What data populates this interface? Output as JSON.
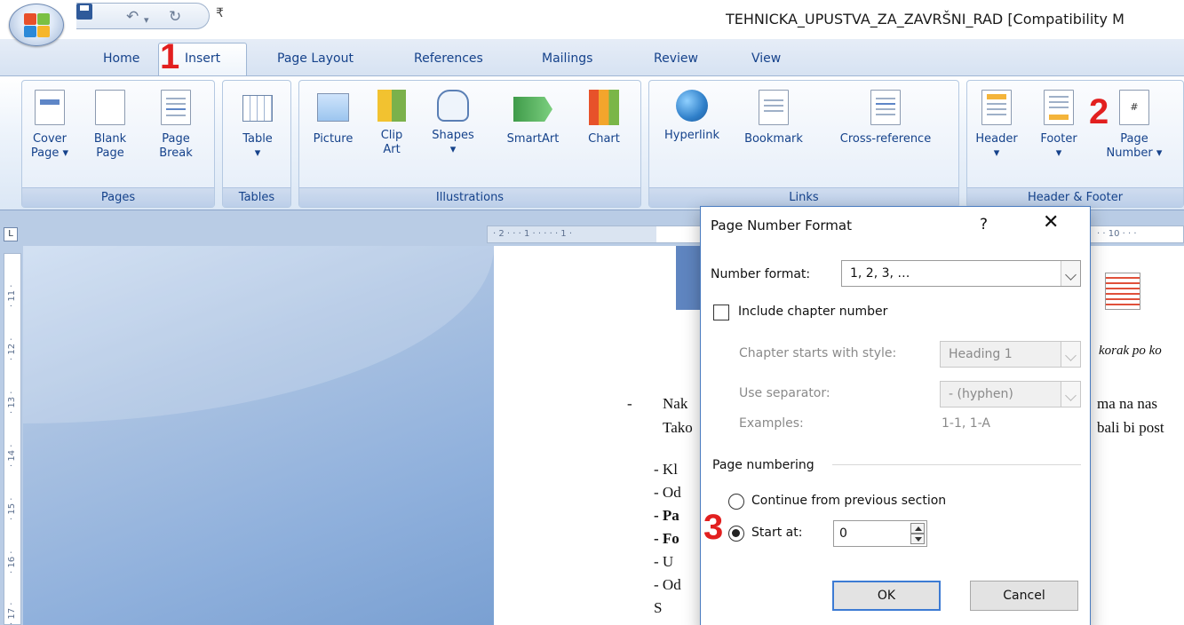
{
  "window": {
    "title": "TEHNICKA_UPUSTVA_ZA_ZAVRŠNI_RAD [Compatibility M"
  },
  "quick_access": {
    "save_icon": "save-icon",
    "undo_icon": "undo-icon",
    "redo_icon": "redo-icon",
    "more": "₹"
  },
  "tabs": [
    {
      "label": "Home"
    },
    {
      "label": "Insert",
      "selected": true
    },
    {
      "label": "Page Layout"
    },
    {
      "label": "References"
    },
    {
      "label": "Mailings"
    },
    {
      "label": "Review"
    },
    {
      "label": "View"
    }
  ],
  "ribbon": {
    "pages": {
      "label": "Pages",
      "cover_page": "Cover",
      "cover_page2": "Page ▾",
      "blank_page": "Blank",
      "blank_page2": "Page",
      "page_break": "Page",
      "page_break2": "Break"
    },
    "tables": {
      "label": "Tables",
      "table": "Table",
      "table2": "▾"
    },
    "illustrations": {
      "label": "Illustrations",
      "picture": "Picture",
      "clip_art": "Clip",
      "clip_art2": "Art",
      "shapes": "Shapes",
      "shapes2": "▾",
      "smartart": "SmartArt",
      "chart": "Chart"
    },
    "links": {
      "label": "Links",
      "hyperlink": "Hyperlink",
      "bookmark": "Bookmark",
      "cross_reference": "Cross-reference"
    },
    "header_footer": {
      "label": "Header & Footer",
      "header": "Header",
      "header2": "▾",
      "footer": "Footer",
      "footer2": "▾",
      "page_number": "Page",
      "page_number2": "Number ▾"
    }
  },
  "ruler": {
    "corner": "L",
    "horizontal": "· 2 · · · 1 · · ·   · · 1 ·",
    "horizontal_right": "· · 10 · · ·",
    "vertical": [
      "· 11 ·",
      "· 12 ·",
      "· 13 ·",
      "· 14 ·",
      "· 15 ·",
      "· 16 ·",
      "· 17 ·"
    ]
  },
  "document": {
    "caption_right": "korak po ko",
    "dash": "-",
    "line1_left": "Nak",
    "line1_right": "ma na nas",
    "line2_left": "Tako",
    "line2_right": "bali bi post",
    "items": [
      "- Kl",
      "- Od",
      "- Pa",
      "- Fo",
      "- U",
      "- Od",
      "S"
    ]
  },
  "dialog": {
    "title": "Page Number Format",
    "help": "?",
    "close": "✕",
    "number_format_label": "Number format:",
    "number_format_value": "1, 2, 3, …",
    "include_chapter_label": "Include chapter number",
    "include_chapter_checked": false,
    "chapter_style_label": "Chapter starts with style:",
    "chapter_style_value": "Heading 1",
    "separator_label": "Use separator:",
    "separator_value": "-   (hyphen)",
    "examples_label": "Examples:",
    "examples_value": "1-1, 1-A",
    "page_numbering_label": "Page numbering",
    "continue_label": "Continue from previous section",
    "start_at_label": "Start at:",
    "start_at_value": "0",
    "ok": "OK",
    "cancel": "Cancel"
  },
  "markers": {
    "step1": "1",
    "step2": "2",
    "step3": "3"
  },
  "colors": {
    "accent": "#15428b",
    "marker": "#e21f1f",
    "dialog_border": "#4a7cc0",
    "ok_border": "#3d7bd4"
  }
}
